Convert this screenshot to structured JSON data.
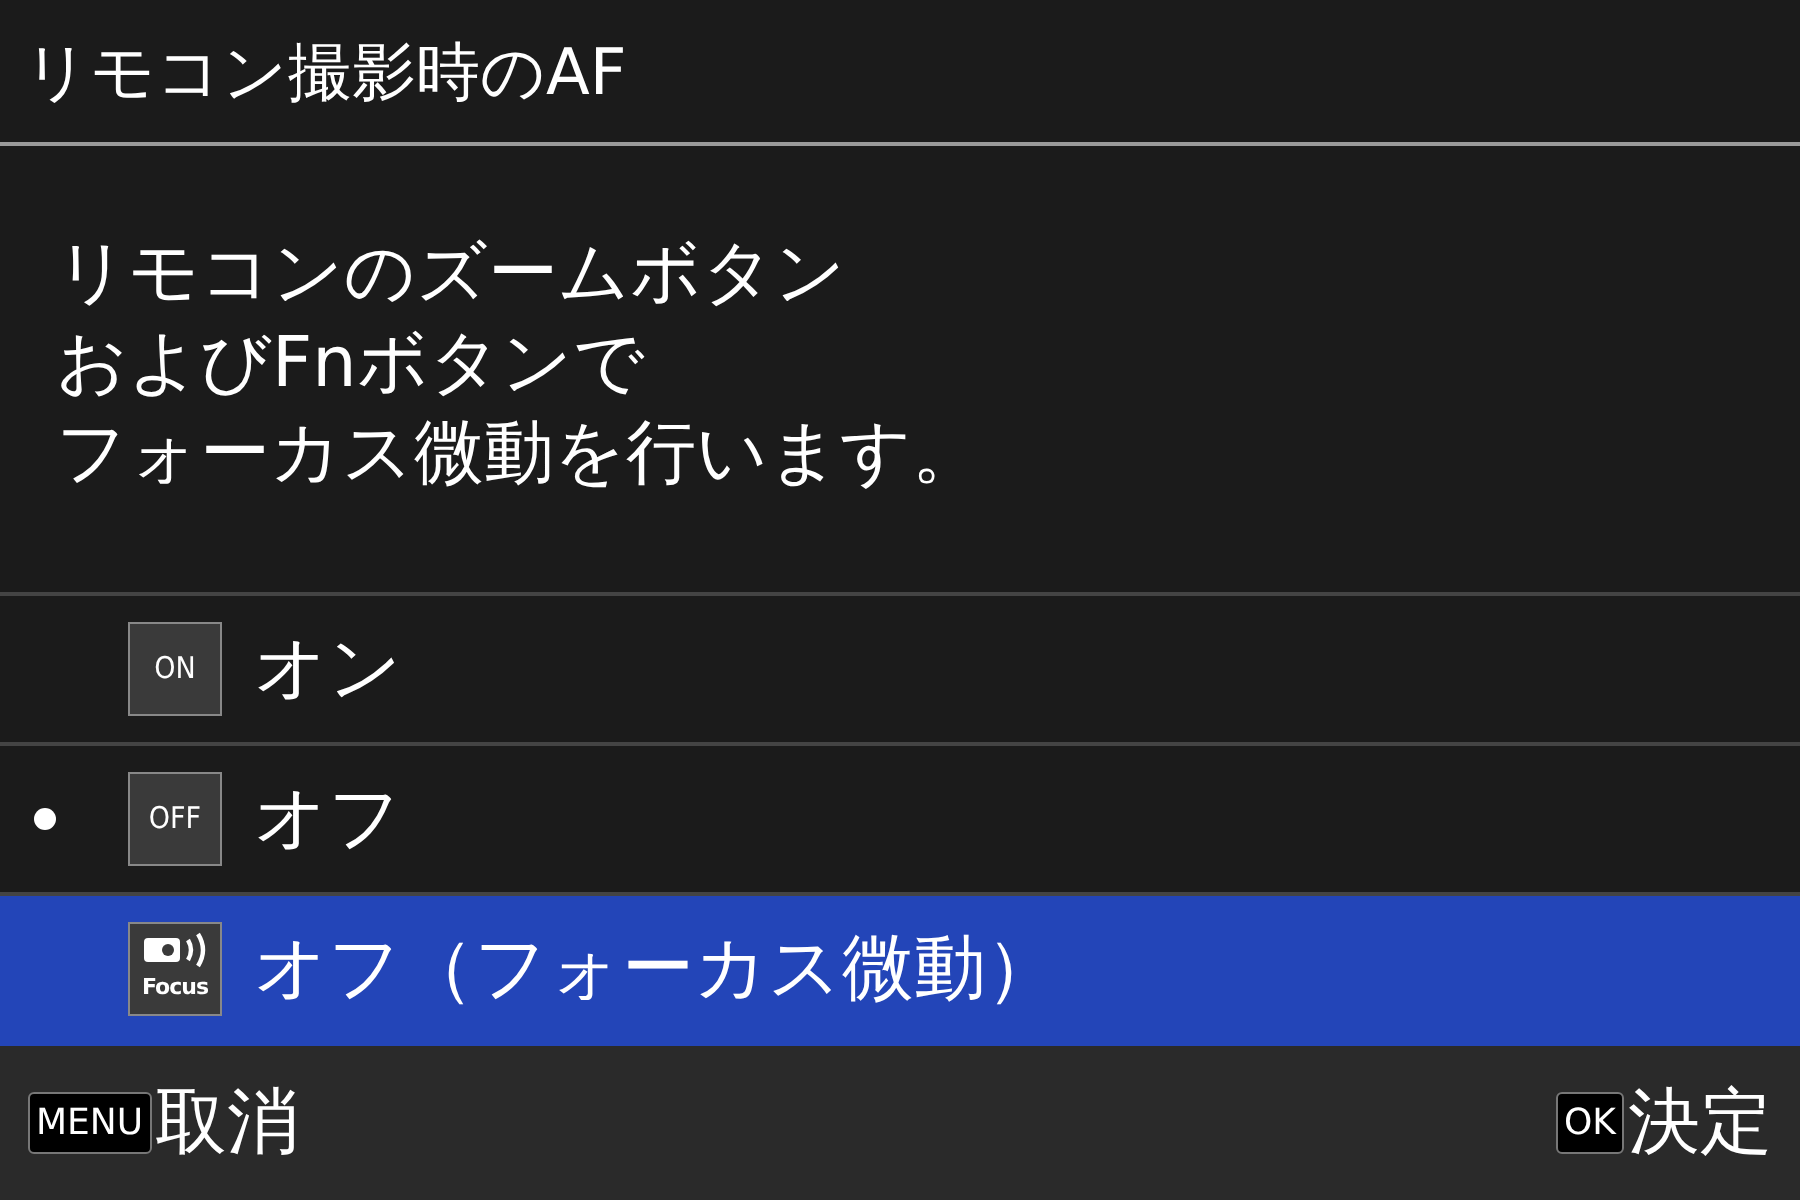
{
  "title": "リモコン撮影時のAF",
  "description": [
    "リモコンのズームボタン",
    "およびFnボタンで",
    "フォーカス微動を行います。"
  ],
  "options": [
    {
      "kind": "text",
      "icon_label": "ON",
      "label": "オン",
      "current": false,
      "selected": false
    },
    {
      "kind": "text",
      "icon_label": "OFF",
      "label": "オフ",
      "current": true,
      "selected": false
    },
    {
      "kind": "focus",
      "icon_label": "Focus",
      "label": "オフ（フォーカス微動）",
      "current": false,
      "selected": true
    }
  ],
  "footer": [
    {
      "key": "MENU",
      "label": "取消"
    },
    {
      "key": "OK",
      "label": "決定"
    }
  ]
}
